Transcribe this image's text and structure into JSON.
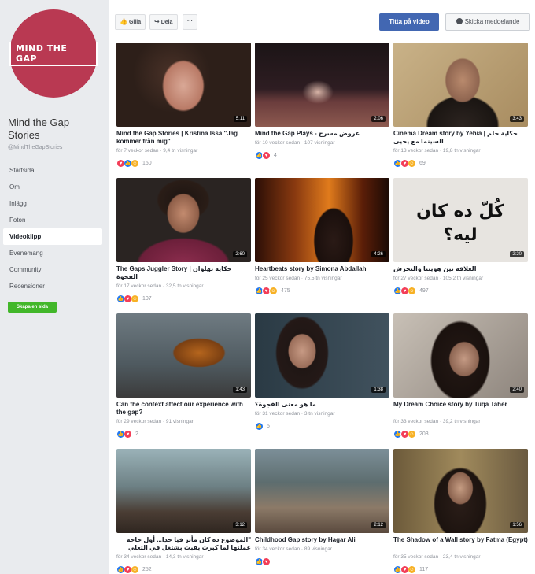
{
  "sidebar": {
    "logo_text": "MIND THE GAP",
    "page_name": "Mind the Gap Stories",
    "handle": "@MindTheGapStories",
    "nav": [
      "Startsida",
      "Om",
      "Inlägg",
      "Foton",
      "Videoklipp",
      "Evenemang",
      "Community",
      "Recensioner"
    ],
    "active_index": 4,
    "create_page_label": "Skapa en sida"
  },
  "topbar": {
    "like_label": "Gilla",
    "share_label": "Dela",
    "more_label": "···",
    "watch_label": "Titta på video",
    "message_label": "Skicka meddelande"
  },
  "videos": [
    {
      "title": "Mind the Gap Stories | Kristina Issa \"Jag kommer från mig\"",
      "meta": "för 7 veckor sedan · 9,4 tn visningar",
      "duration": "5:11",
      "reactions": [
        "love",
        "like",
        "haha"
      ],
      "count": "150"
    },
    {
      "title": "Mind the Gap Plays - عروض مسرح",
      "meta": "för 10 veckor sedan · 107 visningar",
      "duration": "2:06",
      "reactions": [
        "like",
        "love"
      ],
      "count": "4"
    },
    {
      "title": "Cinema Dream story by Yehia | حكاية حلم السينما مع يحيى",
      "meta": "för 13 veckor sedan · 19,8 tn visningar",
      "duration": "3:43",
      "reactions": [
        "like",
        "love",
        "haha"
      ],
      "count": "69"
    },
    {
      "title": "The Gaps Juggler Story | حكاية بهلوان الفجوة",
      "meta": "för 17 veckor sedan · 32,5 tn visningar",
      "duration": "2:60",
      "reactions": [
        "like",
        "love",
        "haha"
      ],
      "count": "107"
    },
    {
      "title": "Heartbeats story by Simona Abdallah",
      "meta": "för 25 veckor sedan · 75,5 tn visningar",
      "duration": "4:26",
      "reactions": [
        "like",
        "love",
        "haha"
      ],
      "count": "475"
    },
    {
      "title": "العلاقة بين هويتنا والتحرش",
      "meta": "för 27 veckor sedan · 105,2 tn visningar",
      "duration": "2:20",
      "reactions": [
        "like",
        "love",
        "haha"
      ],
      "count": "497"
    },
    {
      "title": "Can the context affect our experience with the gap?",
      "meta": "för 29 veckor sedan · 91 visningar",
      "duration": "1:43",
      "reactions": [
        "like",
        "love"
      ],
      "count": "2"
    },
    {
      "title": "ما هو معنى الفجوة؟",
      "meta": "för 31 veckor sedan · 3 tn visningar",
      "duration": "1:38",
      "reactions": [
        "like"
      ],
      "count": "5"
    },
    {
      "title": "My Dream Choice story by Tuqa Taher",
      "meta": "för 33 veckor sedan · 39,2 tn visningar",
      "duration": "2:40",
      "reactions": [
        "like",
        "love",
        "haha"
      ],
      "count": "203"
    },
    {
      "title": "\"الموضوع ده كان مأثر فيا جدا... أول حاجة عملتها لما كبرت بقيت بشتغل في التعلي",
      "meta": "för 34 veckor sedan · 14,3 tn visningar",
      "duration": "3:12",
      "reactions": [
        "like",
        "love",
        "haha"
      ],
      "count": "252"
    },
    {
      "title": "Childhood Gap story by Hagar Ali",
      "meta": "för 34 veckor sedan · 89 visningar",
      "duration": "2:12",
      "reactions": [
        "like",
        "love"
      ],
      "count": ""
    },
    {
      "title": "The Shadow of a Wall story by Fatma (Egypt)",
      "meta": "för 35 veckor sedan · 23,4 tn visningar",
      "duration": "1:56",
      "reactions": [
        "like",
        "love",
        "haha"
      ],
      "count": "117"
    }
  ],
  "thumb_text_6": "كُلّ ده كان ليه؟",
  "colors": {
    "brand": "#b93952",
    "primary": "#4267b2",
    "green": "#42b72a"
  }
}
